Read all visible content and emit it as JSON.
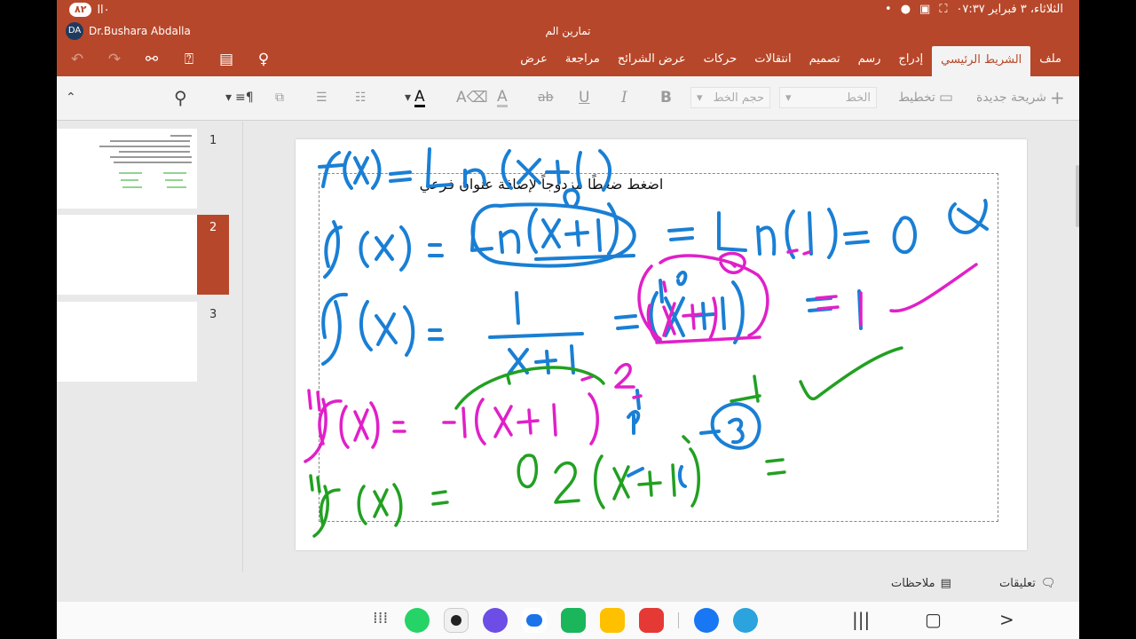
{
  "statusbar": {
    "battery": "٨٢",
    "signal": "ll٠",
    "datetime": "الثلاثاء، ٣ فبراير ٠٧:٣٧"
  },
  "titlebar": {
    "user_initials": "DA",
    "user_name": "Dr.Bushara Abdalla",
    "doc_title": "تمارين الم"
  },
  "quick_access": {
    "undo_icon": "undo-icon",
    "redo_icon": "redo-icon",
    "share_icon": "share-icon",
    "present_icon": "present-icon",
    "save_icon": "save-icon",
    "idea_icon": "lightbulb-icon"
  },
  "tabs": [
    {
      "label": "ملف",
      "active": false
    },
    {
      "label": "الشريط الرئيسي",
      "active": true
    },
    {
      "label": "إدراج",
      "active": false
    },
    {
      "label": "رسم",
      "active": false
    },
    {
      "label": "تصميم",
      "active": false
    },
    {
      "label": "انتقالات",
      "active": false
    },
    {
      "label": "حركات",
      "active": false
    },
    {
      "label": "عرض الشرائح",
      "active": false
    },
    {
      "label": "مراجعة",
      "active": false
    },
    {
      "label": "عرض",
      "active": false
    }
  ],
  "toolbar": {
    "new_slide": "شريحة جديدة",
    "layout": "تخطيط",
    "font_placeholder": "الخط",
    "font_size_placeholder": "حجم الخط",
    "bold": "B",
    "italic": "I",
    "underline": "U",
    "strike": "ab",
    "font_color_letter": "A",
    "highlight_letter": "A",
    "text_color_letter": "A"
  },
  "slides": [
    {
      "number": "1",
      "selected": false
    },
    {
      "number": "2",
      "selected": true
    },
    {
      "number": "3",
      "selected": false
    }
  ],
  "slide": {
    "subtitle_placeholder": "اضغط ضغطًا مزدوجاً لإضافة عنوان فرعي"
  },
  "bottom": {
    "comments": "تعليقات",
    "notes": "ملاحظات"
  },
  "colors": {
    "accent": "#b7472a",
    "ink_blue": "#1a7fd4",
    "ink_magenta": "#e020c8",
    "ink_green": "#22a022"
  }
}
